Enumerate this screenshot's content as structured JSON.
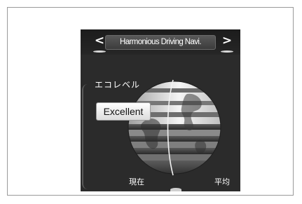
{
  "screen": {
    "title": "Harmonious Driving Navi.",
    "nav_prev": "<",
    "nav_next": ">"
  },
  "eco": {
    "label": "エコレベル",
    "rating": "Excellent",
    "current_label": "現在",
    "average_label": "平均"
  },
  "icons": {
    "prev": "chevron-left-icon",
    "next": "chevron-right-icon",
    "globe": "eco-globe-icon"
  },
  "colors": {
    "screen_bg": "#2b2b2b",
    "globe_light": "#f2f2f2",
    "globe_dark": "#2f2f2f",
    "text": "#ffffff",
    "badge_bg": "#ffffff"
  }
}
